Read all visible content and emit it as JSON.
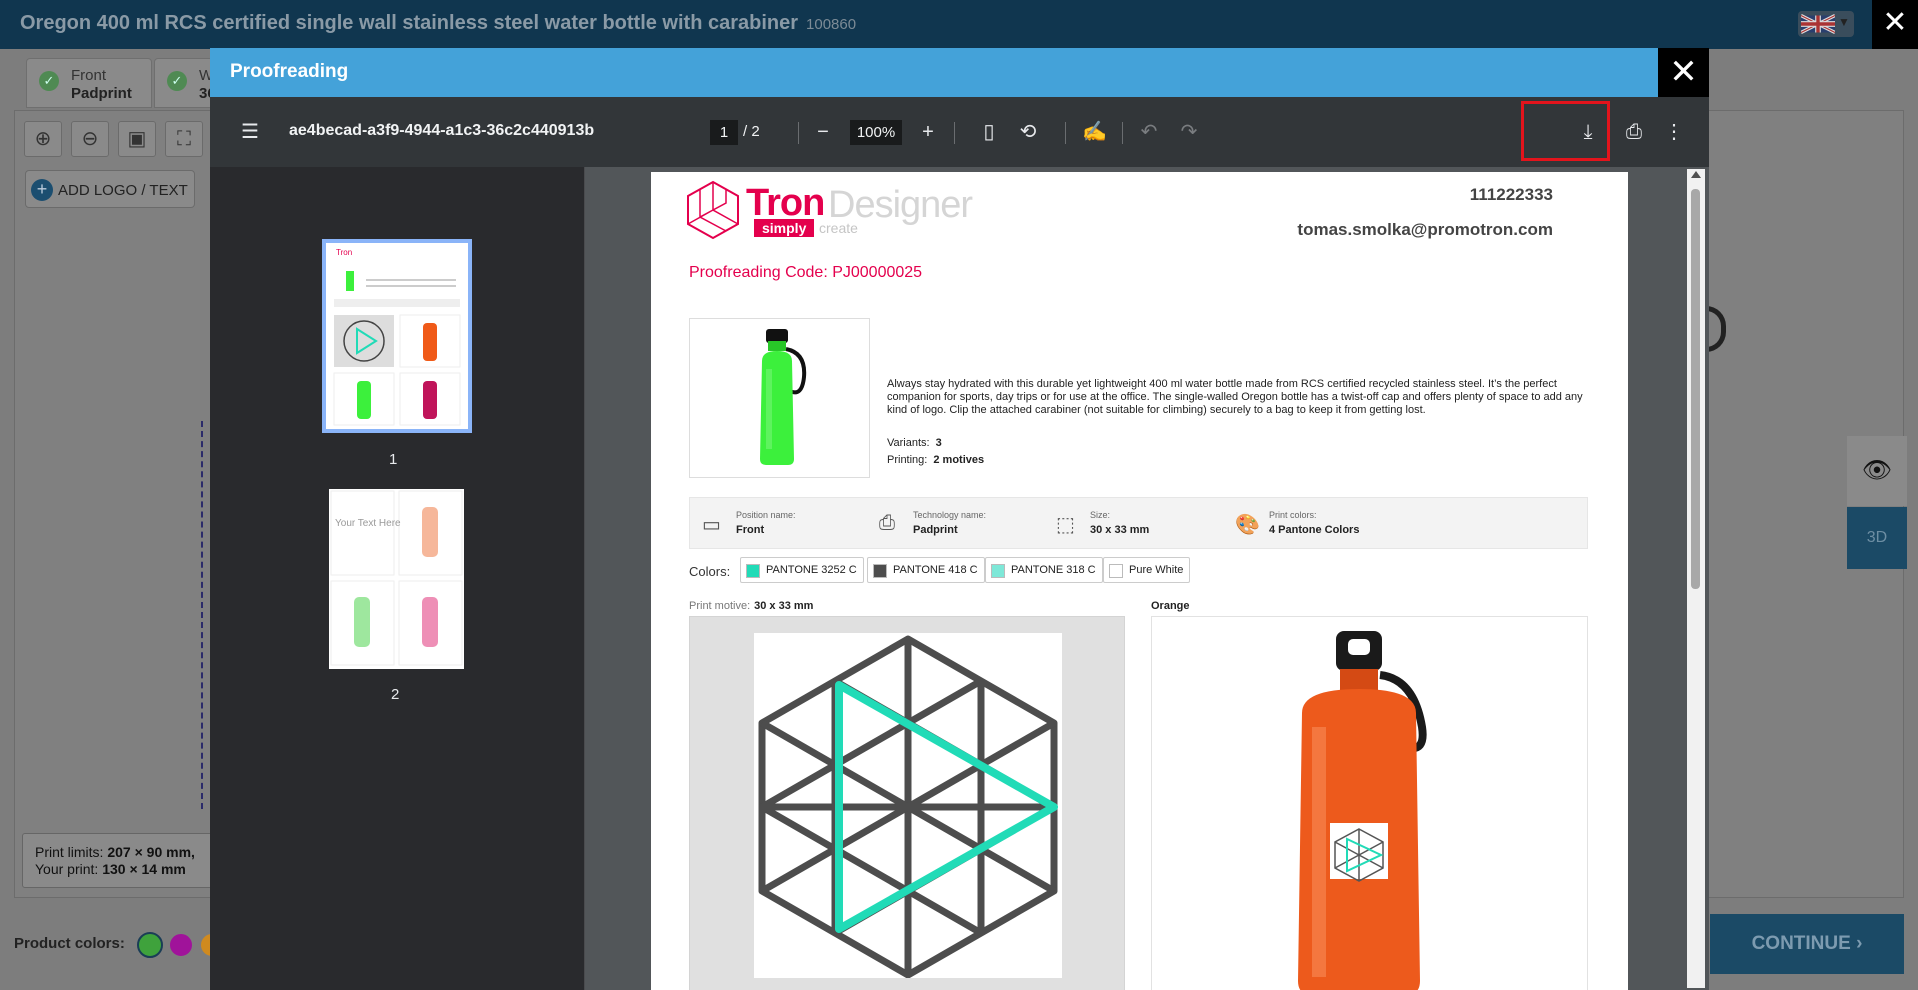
{
  "app": {
    "title": "Oregon 400 ml RCS certified single wall stainless steel water bottle with carabiner",
    "code": "100860",
    "close": "✕",
    "tabs": [
      {
        "line1": "Front",
        "line2": "Padprint"
      },
      {
        "line1": "W",
        "line2": "36"
      }
    ],
    "add_logo_label": "ADD LOGO / TEXT",
    "print_limits_label": "Print limits:",
    "print_limits_value": "207 × 90 mm,",
    "your_print_label": "Your print:",
    "your_print_value": "130 × 14 mm",
    "product_colors_label": "Product colors:",
    "product_colors": [
      "#3fa23c",
      "#a0139a",
      "#d08a1f"
    ],
    "continue_label": "CONTINUE ›",
    "btn_3d_label": "3D"
  },
  "modal": {
    "title": "Proofreading",
    "close": "✕",
    "toolbar": {
      "doc_name": "ae4becad-a3f9-4944-a1c3-36c2c440913b",
      "current_page": "1",
      "total_pages": "/  2",
      "zoom": "100%"
    },
    "thumbnails": [
      {
        "label": "1",
        "selected": true
      },
      {
        "label": "2",
        "selected": false,
        "preview_text": "Your Text Here"
      }
    ]
  },
  "document": {
    "logo_main": "Tron",
    "logo_secondary": "Designer",
    "logo_tag": "simply",
    "logo_tag2": "create",
    "phone": "111222333",
    "email": "tomas.smolka@promotron.com",
    "proof_code": "Proofreading Code: PJ00000025",
    "description": "Always stay hydrated with this durable yet lightweight 400 ml water bottle made from RCS certified recycled stainless steel. It’s the perfect companion for sports, day trips or for use at the office. The single-walled Oregon bottle has a twist-off cap and offers plenty of space to add any kind of logo. Clip the attached carabiner (not suitable for climbing) securely to a bag to keep it from getting lost.",
    "variants_label": "Variants:",
    "variants_value": "3",
    "printing_label": "Printing:",
    "printing_value": "2 motives",
    "info": [
      {
        "key": "Position name:",
        "value": "Front",
        "icon": "position-icon"
      },
      {
        "key": "Technology name:",
        "value": "Padprint",
        "icon": "printer-icon"
      },
      {
        "key": "Size:",
        "value": "30 x 33 mm",
        "icon": "size-icon"
      },
      {
        "key": "Print colors:",
        "value": "4 Pantone Colors",
        "icon": "palette-icon"
      }
    ],
    "colors_label": "Colors:",
    "color_chips": [
      {
        "name": "PANTONE 3252 C",
        "hex": "#21dbb7"
      },
      {
        "name": "PANTONE 418 C",
        "hex": "#4d4d4d"
      },
      {
        "name": "PANTONE 318 C",
        "hex": "#7ee8d8"
      },
      {
        "name": "Pure White",
        "hex": "#ffffff"
      }
    ],
    "print_motive_label": "Print motive:",
    "print_motive_value": "30 x 33 mm",
    "variant_name": "Orange"
  }
}
